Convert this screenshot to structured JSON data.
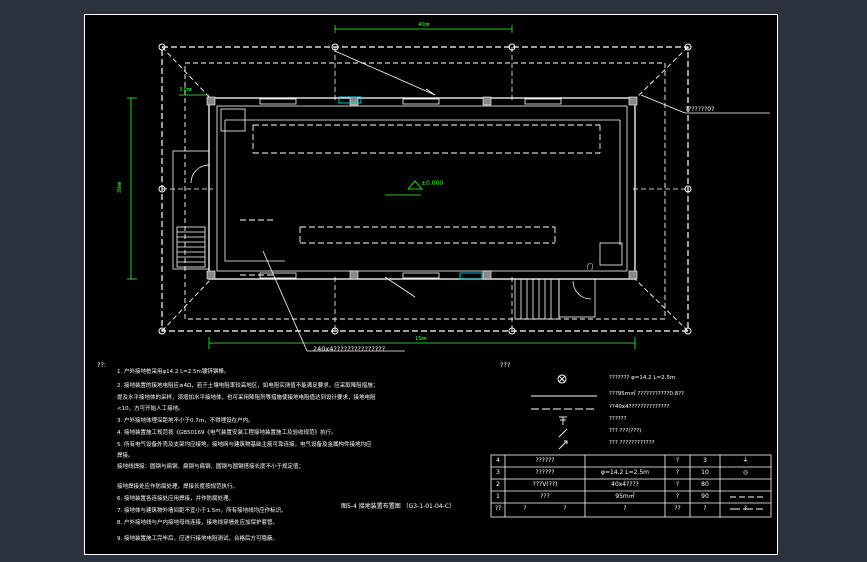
{
  "drawing": {
    "dim_top": "40㎜",
    "dim_left": "30㎜",
    "dim_bottom": "15㎜",
    "dim_small": "3.0㎜",
    "level_mark": "±0.000",
    "label_top_right": "???????0?",
    "label_bottom": "240x4???????????????",
    "door_mark": "门"
  },
  "notes": {
    "heading": "??:",
    "items": [
      "1. 户外接地桩采用φ14.2  L=2.5m镀锌钢棒。",
      "2. 接地装置的接地电阻应≤4Ω，若于土壤电阻率较高地区，如电阻实测值不能满足要求，应采取降阻措施；",
      "提及水平接地体的采样，须增加水平接地体，也可采用降阻剂等措施使接地电阻值达到设计要求，接地电阻",
      "<10，方可开始人工接地。",
      "3. 户外接地体埋深距地不小于0.7m，不得埋设在户内。",
      "4. 接地装置施工规范按《GB50169《电气装置安装工程接地装置施工及验收规范》执行。",
      "5. 所有电气设备外壳及支架均应接地，接地网与建筑物基础主筋可靠连接，电气设备及金属构件接地均应",
      "焊接。",
      "   接地线焊接：圆钢与扁钢、扁钢与扁钢、圆钢与圆钢搭接长度不小于规定值；",
      "   接地焊接处应作防腐处理，焊接长度按规范执行。",
      "6. 接地装置各连接处应用焊接，并作防腐处理。",
      "7. 接地体与建筑物外墙间距不宜小于1.5m，所有接地线均应作标识。",
      "8. 户外接地线与户内接地母线连接，接地线穿墙处应加保护套管。",
      "9. 接地装置施工完毕后，应进行接地电阻测试，合格后方可隐蔽。"
    ],
    "drawing_no": "图5-4  接地装置布置图 （G3-1-01-04-C）"
  },
  "legend": {
    "heading": "???",
    "items": [
      {
        "text": "???????    φ=14.2  L=2.5m",
        "symbol": "circle-x"
      },
      {
        "text": "???95m㎡   ???????????0.8??",
        "symbol": "line-solid"
      },
      {
        "text": "??40x4??????????????",
        "symbol": "line-dash"
      },
      {
        "text": "??????",
        "symbol": "ground"
      },
      {
        "text": "???  ???(???)",
        "symbol": "diag"
      },
      {
        "text": "???  ????????????",
        "symbol": "diag-arrow"
      }
    ]
  },
  "table": {
    "rows": [
      [
        "4",
        "??????",
        "",
        "?",
        "3",
        "⏚"
      ],
      [
        "3",
        "??????",
        "φ=14.2  L=2.5m",
        "?",
        "10",
        "◎"
      ],
      [
        "2",
        "???V(??)",
        "40x4????",
        "?",
        "80",
        ""
      ],
      [
        "1",
        "???",
        "95m㎡",
        "?",
        "90",
        ""
      ]
    ],
    "header": [
      "??",
      "?",
      "?",
      "?",
      "??",
      "?",
      "?"
    ]
  },
  "colors": {
    "background": "#2b313d",
    "sheet": "#000000",
    "line": "#ffffff",
    "dimension": "#33ff33",
    "accent": "#00e5ff"
  }
}
